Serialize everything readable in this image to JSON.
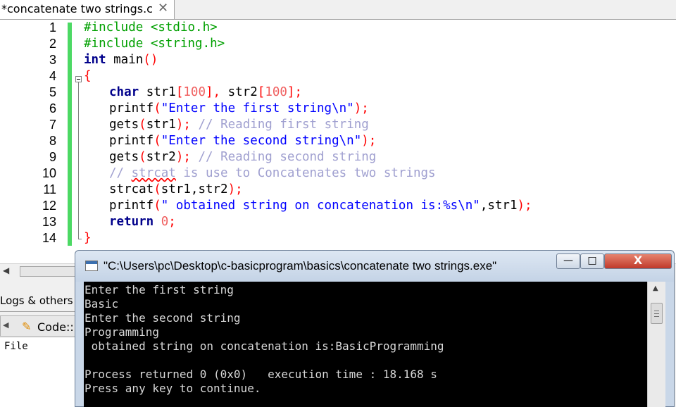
{
  "editor": {
    "tab_title": "*concatenate two strings.c",
    "tab_close": "✕",
    "line_numbers": [
      "1",
      "2",
      "3",
      "4",
      "5",
      "6",
      "7",
      "8",
      "9",
      "10",
      "11",
      "12",
      "13",
      "14"
    ],
    "code": {
      "l1": "#include <stdio.h>",
      "l2": "#include <string.h>",
      "l3_kw": "int",
      "l3_fn": " main",
      "l3_p": "()",
      "l4": "{",
      "l5_kw": "char",
      "l5_a": " str1",
      "l5_b": "[",
      "l5_c": "100",
      "l5_d": "],",
      "l5_e": " str2",
      "l5_f": "[",
      "l5_g": "100",
      "l5_h": "];",
      "l6_fn": "printf",
      "l6_p1": "(",
      "l6_s": "\"Enter the first string\\n\"",
      "l6_p2": ");",
      "l7_fn": "gets",
      "l7_p1": "(",
      "l7_a": "str1",
      "l7_p2": ");",
      "l7_c": " // Reading first string",
      "l8_fn": "printf",
      "l8_p1": "(",
      "l8_s": "\"Enter the second string\\n\"",
      "l8_p2": ");",
      "l9_fn": "gets",
      "l9_p1": "(",
      "l9_a": "str2",
      "l9_p2": ");",
      "l9_c": " // Reading second string",
      "l10_a": "// ",
      "l10_b": "strcat",
      "l10_c": " is use to Concatenates two strings",
      "l11_fn": "strcat",
      "l11_p1": "(",
      "l11_a": "str1,str2",
      "l11_p2": ");",
      "l12_fn": "printf",
      "l12_p1": "(",
      "l12_s": "\" obtained string on concatenation is:%s\\n\"",
      "l12_a": ",str1",
      "l12_p2": ");",
      "l13_kw": "return",
      "l13_n": " 0",
      "l13_p": ";",
      "l14": "}"
    }
  },
  "lower_panel": {
    "hscroll_left": "◀",
    "logs_tab": "Logs & others",
    "code_tab_arrow": "◀",
    "code_tab_label": "Code::B",
    "file_label": "File"
  },
  "console": {
    "title": "\"C:\\Users\\pc\\Desktop\\c-basicprogram\\basics\\concatenate two strings.exe\"",
    "min_glyph": "—",
    "max_glyph": "□",
    "close_glyph": "X",
    "scroll_up": "▲",
    "lines": [
      "Enter the first string",
      "Basic",
      "Enter the second string",
      "Programming",
      " obtained string on concatenation is:BasicProgramming",
      "",
      "Process returned 0 (0x0)   execution time : 18.168 s",
      "Press any key to continue."
    ]
  }
}
